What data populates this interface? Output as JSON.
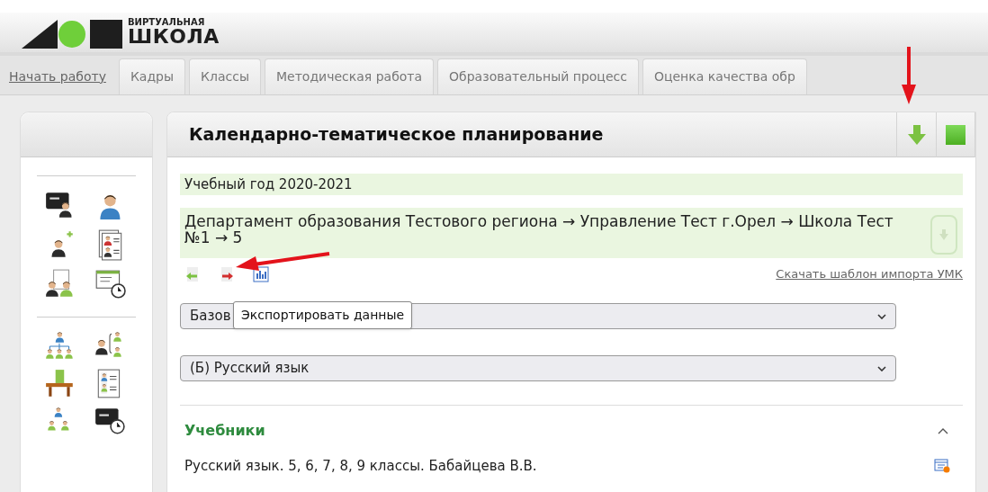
{
  "logo": {
    "line1": "ВИРТУАЛЬНАЯ",
    "line2": "ШКОЛА"
  },
  "nav_tabs": [
    {
      "label": "Начать работу",
      "kind": "link"
    },
    {
      "label": "Кадры",
      "kind": "tab"
    },
    {
      "label": "Классы",
      "kind": "tab"
    },
    {
      "label": "Методическая работа",
      "kind": "tab"
    },
    {
      "label": "Образовательный процесс",
      "kind": "tab"
    },
    {
      "label": "Оценка качества обр",
      "kind": "tab"
    }
  ],
  "panel": {
    "title": "Календарно-тематическое планирование",
    "school_year": "Учебный год 2020-2021",
    "path": "Департамент образования Тестового региона → Управление Тест г.Орел → Школа Тест №1 → 5",
    "template_link": "Скачать шаблон импорта УМК",
    "tooltip": "Экспортировать данные",
    "selects": [
      {
        "value": "Базов"
      },
      {
        "value": "(Б) Русский язык"
      }
    ],
    "section": {
      "title": "Учебники",
      "expanded": true,
      "items": [
        "Русский язык. 5, 6, 7, 8, 9 классы. Бабайцева В.В."
      ]
    }
  }
}
